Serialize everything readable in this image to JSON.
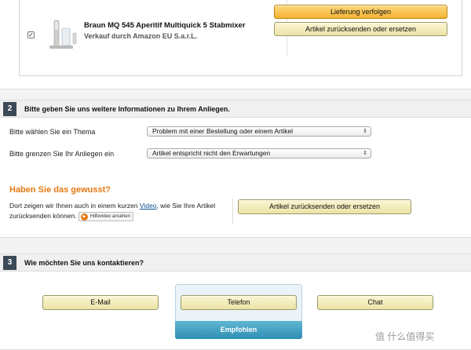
{
  "order": {
    "product_title": "Braun MQ 545 Aperitif Multiquick 5 Stabmixer",
    "seller": "Verkauf durch Amazon EU S.a.r.L.",
    "track_button": "Lieferung verfolgen",
    "return_button": "Artikel zurücksenden oder ersetzen",
    "checkbox_mark": "✓"
  },
  "section2": {
    "number": "2",
    "title": "Bitte geben Sie uns weitere Informationen zu Ihrem Anliegen.",
    "topic_label": "Bitte wählen Sie ein Thema",
    "topic_value": "Problem mit einer Bestellung oder einem Artikel",
    "narrow_label": "Bitte grenzen Sie Ihr Anliegen ein",
    "narrow_value": "Artikel entspricht nicht den Erwartungen",
    "select_arrow": "⇕",
    "know_title": "Haben Sie das gewusst?",
    "know_text_pre": "Dort zeigen wir Ihnen auch in einem kurzen ",
    "know_link": "Video",
    "know_text_post": ", wie Sie Ihre Artikel zurücksenden können.",
    "help_video_label": "Hilfevideo ansehen",
    "return_button": "Artikel zurücksenden oder ersetzen"
  },
  "section3": {
    "number": "3",
    "title": "Wie möchten Sie uns kontaktieren?",
    "email_button": "E-Mail",
    "phone_button": "Telefon",
    "chat_button": "Chat",
    "recommended": "Empfohlen"
  },
  "watermark": "值 什么值得买",
  "colors": {
    "accent_orange": "#e47911",
    "section_number_bg": "#3b4a56",
    "recommended_blue": "#2f8fb3"
  }
}
